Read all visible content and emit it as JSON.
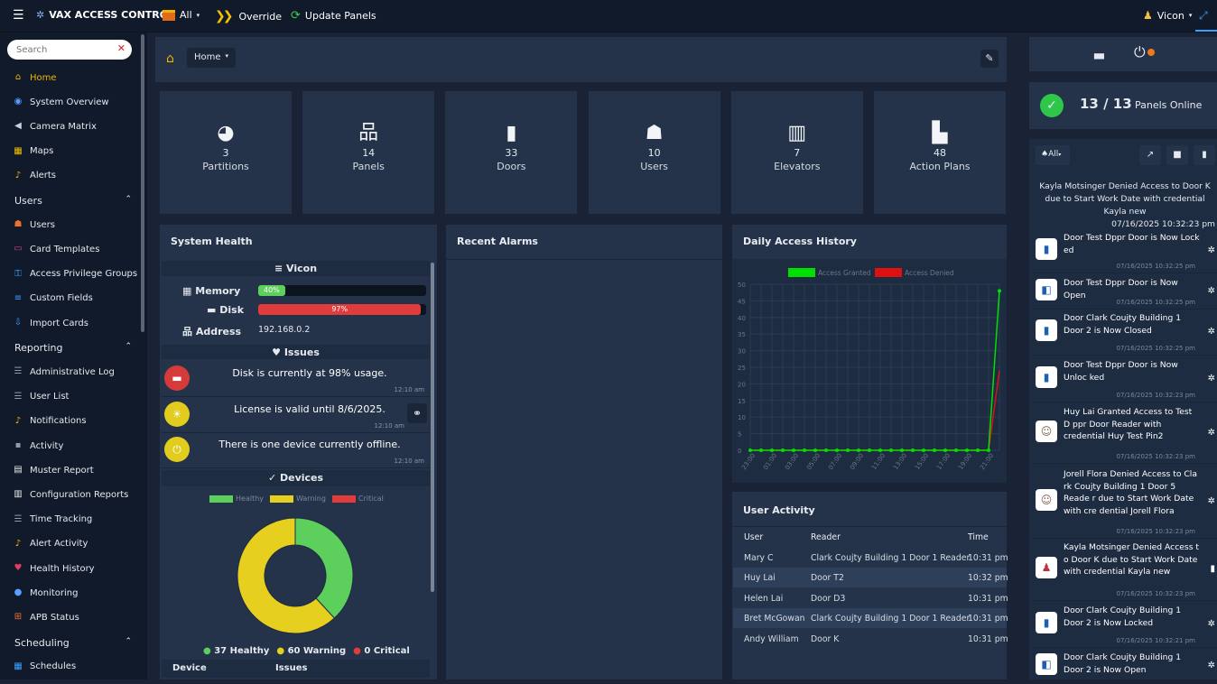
{
  "topbar": {
    "brand": "VAX ACCESS CONTROL",
    "all": "All",
    "override": "Override",
    "update": "Update Panels",
    "user": "Vicon"
  },
  "sidebar": {
    "search_placeholder": "Search",
    "items": [
      {
        "label": "Home",
        "icon": "home-icon",
        "active": true
      },
      {
        "label": "System Overview",
        "icon": "globe-icon"
      },
      {
        "label": "Camera Matrix",
        "icon": "camera-icon"
      },
      {
        "label": "Maps",
        "icon": "map-icon"
      },
      {
        "label": "Alerts",
        "icon": "bell-icon"
      }
    ],
    "users_section": "Users",
    "users_items": [
      {
        "label": "Users",
        "icon": "users-icon"
      },
      {
        "label": "Card Templates",
        "icon": "card-icon"
      },
      {
        "label": "Access Privilege Groups",
        "icon": "key-icon"
      },
      {
        "label": "Custom Fields",
        "icon": "fields-icon"
      },
      {
        "label": "Import Cards",
        "icon": "import-icon"
      }
    ],
    "reporting_section": "Reporting",
    "reporting_items": [
      {
        "label": "Administrative Log",
        "icon": "list-icon"
      },
      {
        "label": "User List",
        "icon": "list-icon"
      },
      {
        "label": "Notifications",
        "icon": "bell-icon"
      },
      {
        "label": "Activity",
        "icon": "activity-icon"
      },
      {
        "label": "Muster Report",
        "icon": "report-icon"
      },
      {
        "label": "Configuration Reports",
        "icon": "config-icon"
      },
      {
        "label": "Time Tracking",
        "icon": "list-icon"
      },
      {
        "label": "Alert Activity",
        "icon": "bell-icon"
      },
      {
        "label": "Health History",
        "icon": "heart-icon"
      },
      {
        "label": "Monitoring",
        "icon": "search-icon"
      },
      {
        "label": "APB Status",
        "icon": "apb-icon"
      }
    ],
    "scheduling_section": "Scheduling",
    "scheduling_items": [
      {
        "label": "Schedules",
        "icon": "calendar-icon"
      }
    ]
  },
  "home_bar": {
    "label": "Home"
  },
  "tiles": [
    {
      "value": "3",
      "label": "Partitions",
      "icon": "pie-icon"
    },
    {
      "value": "14",
      "label": "Panels",
      "icon": "network-icon"
    },
    {
      "value": "33",
      "label": "Doors",
      "icon": "door-icon"
    },
    {
      "value": "10",
      "label": "Users",
      "icon": "users-icon"
    },
    {
      "value": "7",
      "label": "Elevators",
      "icon": "building-icon"
    },
    {
      "value": "48",
      "label": "Action Plans",
      "icon": "scroll-icon"
    }
  ],
  "system_health": {
    "title": "System Health",
    "server": "Vicon",
    "memory_label": "Memory",
    "memory_pct": 40,
    "memory_text": "40%",
    "disk_label": "Disk",
    "disk_pct": 97,
    "disk_text": "97%",
    "address_label": "Address",
    "address": "192.168.0.2",
    "issues_title": "Issues",
    "issues": [
      {
        "text": "Disk is currently at 98% usage.",
        "time": "12:10 am",
        "color": "#d63b3b"
      },
      {
        "text": "License is valid until 8/6/2025.",
        "time": "12:10 am",
        "color": "#e2cc1e"
      },
      {
        "text": "There is one device currently offline.",
        "time": "12:10 am",
        "color": "#e2cc1e"
      }
    ],
    "devices_title": "Devices",
    "legend": {
      "healthy": "Healthy",
      "warning": "Warning",
      "critical": "Critical"
    },
    "donut": {
      "healthy": 37,
      "warning": 60,
      "critical": 0
    },
    "summary": {
      "healthy": "37 Healthy",
      "warning": "60 Warning",
      "critical": "0 Critical"
    },
    "table_head": {
      "device": "Device",
      "issues": "Issues"
    }
  },
  "recent_alarms": {
    "title": "Recent Alarms"
  },
  "chart_data": {
    "type": "line",
    "title": "Daily Access History",
    "legend": [
      "Access Granted",
      "Access Denied"
    ],
    "colors": [
      "#00e000",
      "#e01010"
    ],
    "x": [
      "23:00",
      "00:00",
      "01:00",
      "02:00",
      "03:00",
      "04:00",
      "05:00",
      "06:00",
      "07:00",
      "08:00",
      "09:00",
      "10:00",
      "11:00",
      "12:00",
      "13:00",
      "14:00",
      "15:00",
      "16:00",
      "17:00",
      "18:00",
      "19:00",
      "20:00",
      "21:00",
      "22:00"
    ],
    "x_tick_labels": [
      "23:00",
      "01:00",
      "03:00",
      "05:00",
      "07:00",
      "09:00",
      "11:00",
      "13:00",
      "15:00",
      "17:00",
      "19:00",
      "21:00"
    ],
    "series": [
      {
        "name": "Access Granted",
        "values": [
          0,
          0,
          0,
          0,
          0,
          0,
          0,
          0,
          0,
          0,
          0,
          0,
          0,
          0,
          0,
          0,
          0,
          0,
          0,
          0,
          0,
          0,
          0,
          48
        ]
      },
      {
        "name": "Access Denied",
        "values": [
          0,
          0,
          0,
          0,
          0,
          0,
          0,
          0,
          0,
          0,
          0,
          0,
          0,
          0,
          0,
          0,
          0,
          0,
          0,
          0,
          0,
          0,
          0,
          24
        ]
      }
    ],
    "ylim": [
      0,
      50
    ],
    "yticks": [
      0,
      5,
      10,
      15,
      20,
      25,
      30,
      35,
      40,
      45,
      50
    ],
    "grid": true,
    "legend_position": "top"
  },
  "user_activity": {
    "title": "User Activity",
    "columns": [
      "User",
      "Reader",
      "Time"
    ],
    "rows": [
      [
        "Mary C",
        "Clark Coujty Building 1 Door 1 Reader",
        "10:31 pm"
      ],
      [
        "Huy Lai",
        "Door T2",
        "10:32 pm"
      ],
      [
        "Helen Lai",
        "Door D3",
        "10:31 pm"
      ],
      [
        "Bret McGowan",
        "Clark Coujty Building 1 Door 1 Reader",
        "10:31 pm"
      ],
      [
        "Andy William",
        "Door K",
        "10:31 pm"
      ]
    ]
  },
  "panels_status": {
    "count": "13 / 13",
    "label": "Panels Online"
  },
  "events": {
    "filter": "All",
    "header_event": "Kayla Motsinger Denied Access to Door K due to Start Work Date with credential Kayla new",
    "header_time": "07/16/2025 10:32:23 pm",
    "items": [
      {
        "text": "Door Test Dppr Door is Now Lock ed",
        "time": "07/16/2025 10:32:25 pm",
        "icon": "door-icon"
      },
      {
        "text": "Door Test Dppr Door is Now Open",
        "time": "07/16/2025 10:32:25 pm",
        "icon": "door-open-icon"
      },
      {
        "text": "Door Clark Coujty Building 1 Door 2 is Now Closed",
        "time": "07/16/2025 10:32:25 pm",
        "icon": "door-icon"
      },
      {
        "text": "Door Test Dppr Door is Now Unloc ked",
        "time": "07/16/2025 10:32:23 pm",
        "icon": "door-icon"
      },
      {
        "text": "Huy Lai Granted Access to Test D ppr Door Reader with credential Huy Test Pin2",
        "time": "07/16/2025 10:32:23 pm",
        "icon": "person-photo-icon"
      },
      {
        "text": "Jorell Flora Denied Access to Cla rk Coujty Building 1 Door 5 Reade r due to Start Work Date with cre dential Jorell Flora",
        "time": "07/16/2025 10:32:23 pm",
        "icon": "person-photo-icon"
      },
      {
        "text": "Kayla Motsinger Denied Access t o Door K due to Start Work Date with credential Kayla new",
        "time": "07/16/2025 10:32:23 pm",
        "icon": "user-denied-icon"
      },
      {
        "text": "Door Clark Coujty Building 1 Door 2 is Now Locked",
        "time": "07/16/2025 10:32:21 pm",
        "icon": "door-icon"
      },
      {
        "text": "Door Clark Coujty Building 1 Door 2 is Now Open",
        "time": "",
        "icon": "door-open-icon"
      }
    ]
  }
}
